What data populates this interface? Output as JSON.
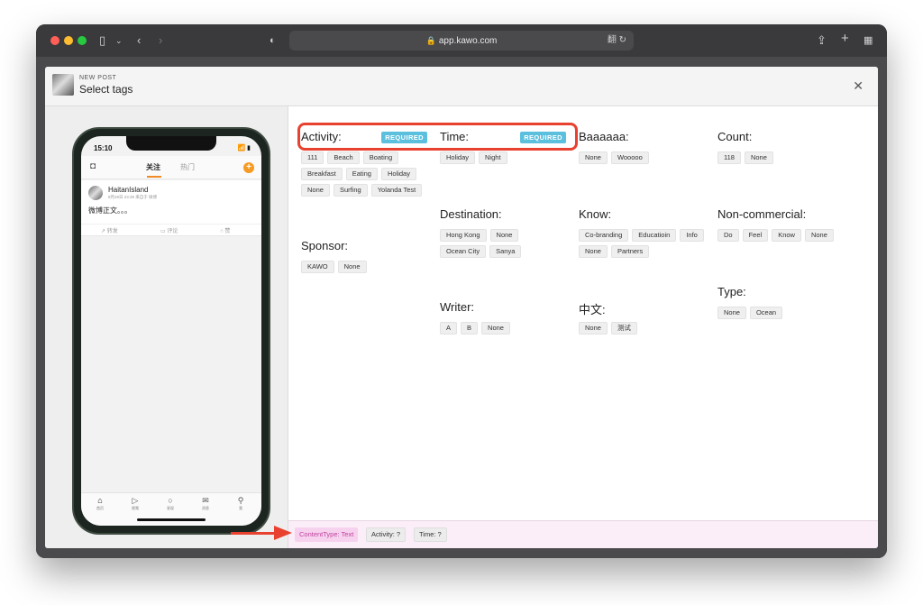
{
  "browser": {
    "url": "app.kawo.com",
    "reader_icon": "翻",
    "reload_icon": "↻"
  },
  "modal": {
    "kicker": "NEW POST",
    "title": "Select tags",
    "close_icon": "✕"
  },
  "phone": {
    "time": "15:10",
    "status_icons": "📶 ▮",
    "tabs": [
      "关注",
      "热门"
    ],
    "post": {
      "user": "HaitanIsland",
      "meta": "8月28日 23:39  来自于 微博",
      "body": "微博正文。。。",
      "actions": [
        "转发",
        "评论",
        "赞"
      ]
    },
    "tabbar": [
      {
        "icon": "⌂",
        "label": "首页"
      },
      {
        "icon": "▷",
        "label": "视频"
      },
      {
        "icon": "○",
        "label": "发现"
      },
      {
        "icon": "✉",
        "label": "消息"
      },
      {
        "icon": "⚲",
        "label": "我"
      }
    ]
  },
  "required_label": "REQUIRED",
  "groups": {
    "activity": {
      "label": "Activity:",
      "tags": [
        "111",
        "Beach",
        "Boating",
        "Breakfast",
        "Eating",
        "Holiday",
        "None",
        "Surfing",
        "Yolanda Test"
      ]
    },
    "time": {
      "label": "Time:",
      "tags": [
        "Holiday",
        "Night"
      ]
    },
    "baaaaaa": {
      "label": "Baaaaaa:",
      "tags": [
        "None",
        "Wooooo"
      ]
    },
    "count": {
      "label": "Count:",
      "tags": [
        "118",
        "None"
      ]
    },
    "destination": {
      "label": "Destination:",
      "tags": [
        "Hong Kong",
        "None",
        "Ocean City",
        "Sanya"
      ]
    },
    "know": {
      "label": "Know:",
      "tags": [
        "Co-branding",
        "Educatioin",
        "Info",
        "None",
        "Partners"
      ]
    },
    "noncommercial": {
      "label": "Non-commercial:",
      "tags": [
        "Do",
        "Feel",
        "Know",
        "None"
      ]
    },
    "sponsor": {
      "label": "Sponsor:",
      "tags": [
        "KAWO",
        "None"
      ]
    },
    "type": {
      "label": "Type:",
      "tags": [
        "None",
        "Ocean"
      ]
    },
    "writer": {
      "label": "Writer:",
      "tags": [
        "A",
        "B",
        "None"
      ]
    },
    "chinese": {
      "label": "中文:",
      "tags": [
        "None",
        "测试"
      ]
    }
  },
  "footer": {
    "tags": [
      "ContentType: Text",
      "Activity: ?",
      "Time: ?"
    ]
  },
  "colors": {
    "required": "#5bc0de",
    "highlight": "#e8412f",
    "footer_bg": "#fbeef8"
  }
}
